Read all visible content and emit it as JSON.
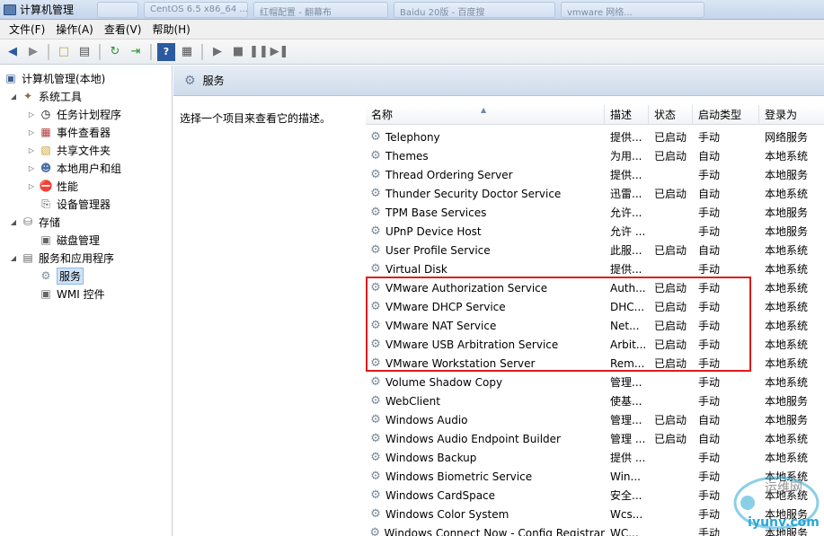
{
  "window": {
    "title": "计算机管理",
    "bg_tabs": [
      "",
      "CentOS 6.5 x86_64 ...",
      "红帽配置 - 翻幕布",
      "Baidu 20版 - 百度搜",
      "vmware 网络..."
    ]
  },
  "menu": [
    "文件(F)",
    "操作(A)",
    "查看(V)",
    "帮助(H)"
  ],
  "toolbar_icons": [
    "back-icon",
    "forward-icon",
    "up-folder-icon",
    "show-tree-icon",
    "refresh-icon",
    "export-icon",
    "help-icon",
    "properties-icon",
    "play-icon",
    "stop-icon",
    "pause-icon",
    "restart-icon"
  ],
  "tree": {
    "root": "计算机管理(本地)",
    "system_tools": "系统工具",
    "task_scheduler": "任务计划程序",
    "event_viewer": "事件查看器",
    "shared_folders": "共享文件夹",
    "local_users": "本地用户和组",
    "performance": "性能",
    "device_manager": "设备管理器",
    "storage": "存储",
    "disk_management": "磁盘管理",
    "services_apps": "服务和应用程序",
    "services": "服务",
    "wmi": "WMI 控件"
  },
  "pane": {
    "header": "服务",
    "description": "选择一个项目来查看它的描述。"
  },
  "columns": [
    "名称",
    "描述",
    "状态",
    "启动类型",
    "登录为"
  ],
  "services": [
    {
      "name": "Telephony",
      "desc": "提供...",
      "status": "已启动",
      "start": "手动",
      "logon": "网络服务"
    },
    {
      "name": "Themes",
      "desc": "为用...",
      "status": "已启动",
      "start": "自动",
      "logon": "本地系统"
    },
    {
      "name": "Thread Ordering Server",
      "desc": "提供...",
      "status": "",
      "start": "手动",
      "logon": "本地服务"
    },
    {
      "name": "Thunder Security Doctor Service",
      "desc": "迅雷...",
      "status": "已启动",
      "start": "自动",
      "logon": "本地系统"
    },
    {
      "name": "TPM Base Services",
      "desc": "允许...",
      "status": "",
      "start": "手动",
      "logon": "本地服务"
    },
    {
      "name": "UPnP Device Host",
      "desc": "允许 ...",
      "status": "",
      "start": "手动",
      "logon": "本地服务"
    },
    {
      "name": "User Profile Service",
      "desc": "此服...",
      "status": "已启动",
      "start": "自动",
      "logon": "本地系统"
    },
    {
      "name": "Virtual Disk",
      "desc": "提供...",
      "status": "",
      "start": "手动",
      "logon": "本地系统"
    },
    {
      "name": "VMware Authorization Service",
      "desc": "Auth...",
      "status": "已启动",
      "start": "手动",
      "logon": "本地系统"
    },
    {
      "name": "VMware DHCP Service",
      "desc": "DHC...",
      "status": "已启动",
      "start": "手动",
      "logon": "本地系统"
    },
    {
      "name": "VMware NAT Service",
      "desc": "Net...",
      "status": "已启动",
      "start": "手动",
      "logon": "本地系统"
    },
    {
      "name": "VMware USB Arbitration Service",
      "desc": "Arbit...",
      "status": "已启动",
      "start": "手动",
      "logon": "本地系统"
    },
    {
      "name": "VMware Workstation Server",
      "desc": "Rem...",
      "status": "已启动",
      "start": "手动",
      "logon": "本地系统"
    },
    {
      "name": "Volume Shadow Copy",
      "desc": "管理...",
      "status": "",
      "start": "手动",
      "logon": "本地系统"
    },
    {
      "name": "WebClient",
      "desc": "使基...",
      "status": "",
      "start": "手动",
      "logon": "本地服务"
    },
    {
      "name": "Windows Audio",
      "desc": "管理...",
      "status": "已启动",
      "start": "自动",
      "logon": "本地服务"
    },
    {
      "name": "Windows Audio Endpoint Builder",
      "desc": "管理 ...",
      "status": "已启动",
      "start": "自动",
      "logon": "本地系统"
    },
    {
      "name": "Windows Backup",
      "desc": "提供 ...",
      "status": "",
      "start": "手动",
      "logon": "本地系统"
    },
    {
      "name": "Windows Biometric Service",
      "desc": "Win...",
      "status": "",
      "start": "手动",
      "logon": "本地系统"
    },
    {
      "name": "Windows CardSpace",
      "desc": "安全...",
      "status": "",
      "start": "手动",
      "logon": "本地系统"
    },
    {
      "name": "Windows Color System",
      "desc": "Wcs...",
      "status": "",
      "start": "手动",
      "logon": "本地服务"
    },
    {
      "name": "Windows Connect Now - Config Registrar",
      "desc": "WC...",
      "status": "",
      "start": "手动",
      "logon": "本地服务"
    }
  ],
  "watermark": {
    "brand": "运维网",
    "url": "iyunv.com"
  },
  "colors": {
    "highlight": "#e01b1b",
    "selection": "#cfe3f8"
  }
}
